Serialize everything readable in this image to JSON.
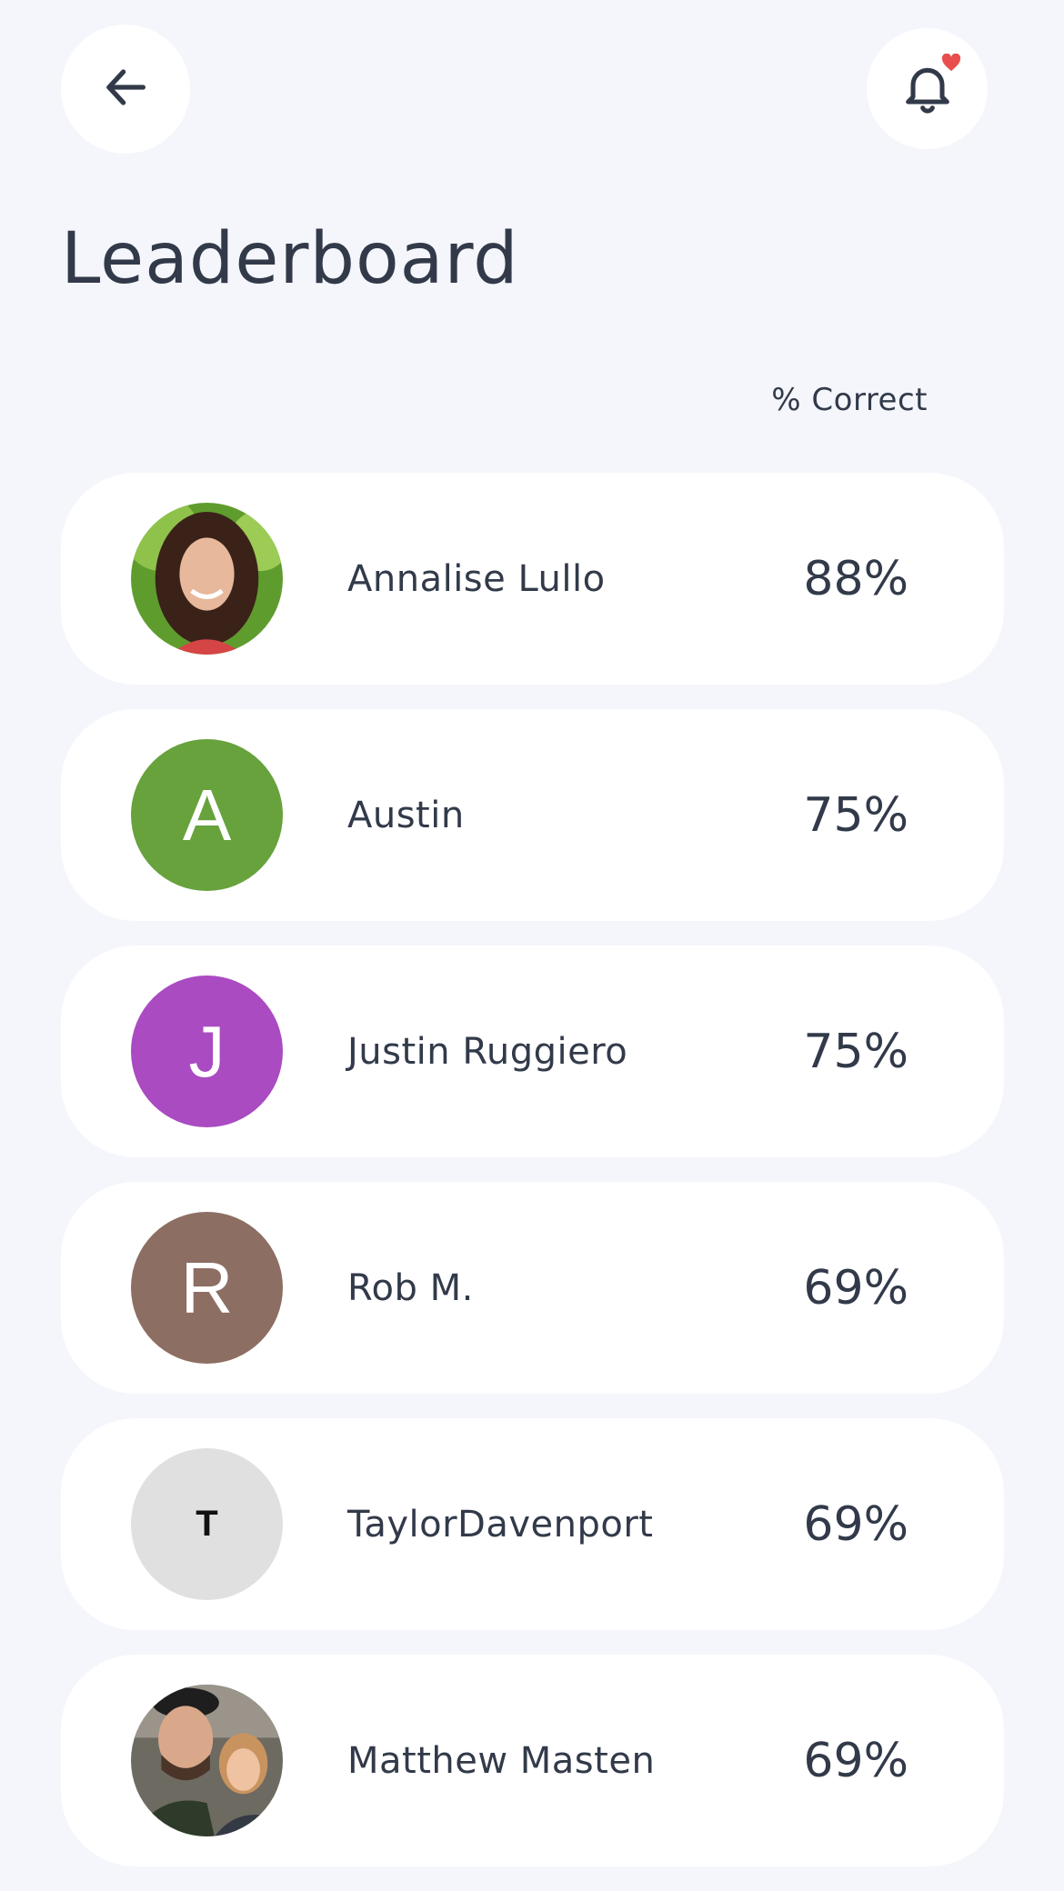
{
  "header": {
    "title": "Leaderboard",
    "back_icon": "arrow-left-icon",
    "notification_icon": "bell-icon",
    "notification_dot_color": "#e94e4e"
  },
  "table": {
    "column_header": "% Correct"
  },
  "leaderboard": [
    {
      "name": "Annalise Lullo",
      "score": "88%",
      "avatar": {
        "type": "photo"
      }
    },
    {
      "name": "Austin",
      "score": "75%",
      "avatar": {
        "type": "initial",
        "letter": "A",
        "color": "#67a23d"
      }
    },
    {
      "name": "Justin Ruggiero",
      "score": "75%",
      "avatar": {
        "type": "initial",
        "letter": "J",
        "color": "#aa4bc2"
      }
    },
    {
      "name": "Rob M.",
      "score": "69%",
      "avatar": {
        "type": "initial",
        "letter": "R",
        "color": "#8d6e63"
      }
    },
    {
      "name": "TaylorDavenport",
      "score": "69%",
      "avatar": {
        "type": "initial",
        "letter": "T",
        "color": "#e0e0e0"
      }
    },
    {
      "name": "Matthew Masten",
      "score": "69%",
      "avatar": {
        "type": "photo"
      }
    }
  ]
}
